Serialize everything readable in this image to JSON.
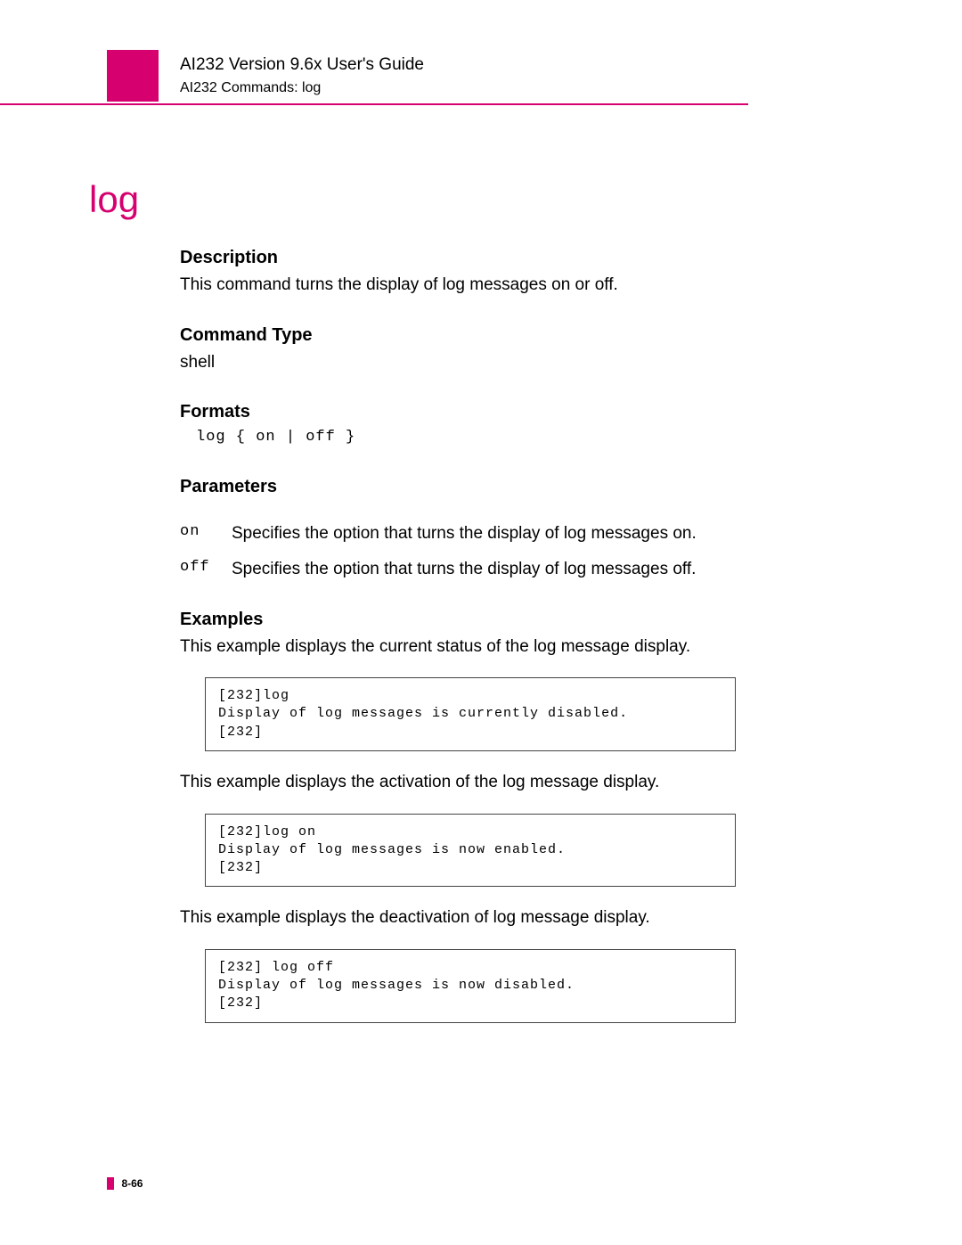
{
  "header": {
    "title": "AI232 Version 9.6x User's Guide",
    "subtitle": "AI232 Commands: log"
  },
  "page_title": "log",
  "sections": {
    "description": {
      "head": "Description",
      "body": "This command turns the display of log messages on or off."
    },
    "command_type": {
      "head": "Command Type",
      "body": "shell"
    },
    "formats": {
      "head": "Formats",
      "code": "log { on | off }"
    },
    "parameters": {
      "head": "Parameters",
      "rows": [
        {
          "key": "on",
          "desc": "Specifies the option that turns the display of log messages on."
        },
        {
          "key": "off",
          "desc": "Specifies the option that turns the display of log messages off."
        }
      ]
    },
    "examples": {
      "head": "Examples",
      "intro1": "This example displays the current status of the log message display.",
      "box1": "[232]log\nDisplay of log messages is currently disabled.\n[232]",
      "intro2": "This example displays the activation of the log message display.",
      "box2": "[232]log on\nDisplay of log messages is now enabled.\n[232]",
      "intro3": "This example displays the deactivation of log message display.",
      "box3": "[232] log off\nDisplay of log messages is now disabled.\n[232]"
    }
  },
  "footer": {
    "page_number": "8-66"
  }
}
